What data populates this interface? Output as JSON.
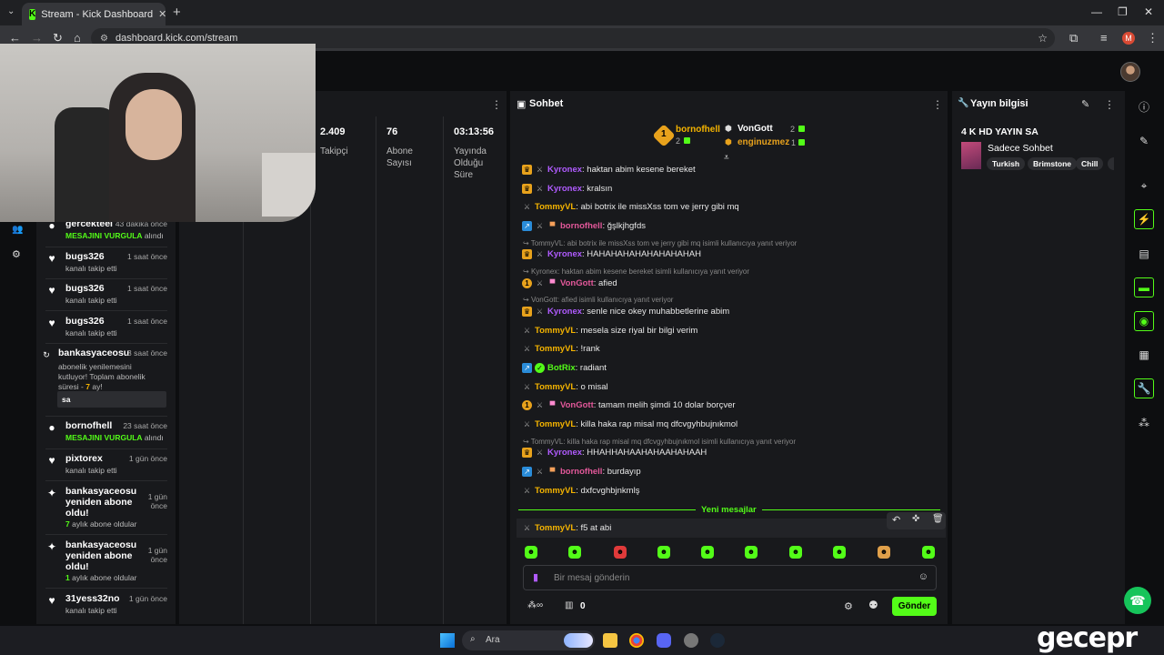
{
  "browser": {
    "tab_title": "Stream - Kick Dashboard",
    "url": "dashboard.kick.com/stream",
    "profile_initial": "M"
  },
  "stats": [
    {
      "value": "2.409",
      "label": "Takipçi"
    },
    {
      "value": "76",
      "label": "Abone Sayısı"
    },
    {
      "value": "03:13:56",
      "label": "Yayında Olduğu Süre"
    }
  ],
  "events": [
    {
      "name": "gercekteel",
      "time": "43 dakika önce",
      "highlight": "MESAJINI VURGULA",
      "sub": "alındı"
    },
    {
      "name": "bugs326",
      "time": "1 saat önce",
      "sub": "kanalı takip etti"
    },
    {
      "name": "bugs326",
      "time": "1 saat önce",
      "sub": "kanalı takip etti"
    },
    {
      "name": "bugs326",
      "time": "1 saat önce",
      "sub": "kanalı takip etti"
    },
    {
      "name": "bankasyaceosu",
      "time": "3 saat önce",
      "text1": "abonelik yenilemesini",
      "text2": "kutluyor! Toplam abonelik",
      "text3": "süresi -",
      "months": "7",
      "months_suffix": "ay!",
      "message": "sa"
    },
    {
      "name": "bornofhell",
      "time": "23 saat önce",
      "highlight": "MESAJINI VURGULA",
      "sub": "alındı"
    },
    {
      "name": "pixtorex",
      "time": "1 gün önce",
      "sub": "kanalı takip etti"
    },
    {
      "name_l1": "bankasyaceosu",
      "name_l2": "yeniden abone",
      "name_l3": "oldu!",
      "time_l1": "1 gün",
      "time_l2": "önce",
      "count": "7",
      "sub": "aylık abone oldular"
    },
    {
      "name_l1": "bankasyaceosu",
      "name_l2": "yeniden abone",
      "name_l3": "oldu!",
      "time_l1": "1 gün",
      "time_l2": "önce",
      "count": "1",
      "sub": "aylık abone oldular"
    },
    {
      "name": "31yess32no",
      "time": "1 gün önce",
      "sub": "kanalı takip etti"
    }
  ],
  "chat": {
    "title": "Sohbet",
    "leaderboard": [
      {
        "rank": "1",
        "name": "bornofhell",
        "count": "2"
      },
      {
        "name": "VonGott",
        "count": "2"
      },
      {
        "name": "enginuzmez",
        "count": "1"
      }
    ],
    "messages": [
      {
        "user": "Kyronex",
        "text": ": haktan abim kesene bereket"
      },
      {
        "user": "Kyronex",
        "text": ": kralsın"
      },
      {
        "user": "TommyVL",
        "text": ": abi botrix ile missXss tom ve jerry gibi mq"
      },
      {
        "user": "bornofhell",
        "text": ": ğşlkjhgfds"
      },
      {
        "reply": "TommyVL: abi botrix ile missXss tom ve jerry gibi mq isimli kullanıcıya yanıt veriyor"
      },
      {
        "user": "Kyronex",
        "text": ": HAHAHAHAHAHAHAHAHAH"
      },
      {
        "reply": "Kyronex: haktan abim kesene bereket isimli kullanıcıya yanıt veriyor"
      },
      {
        "user": "VonGott",
        "text": ": afied"
      },
      {
        "reply": "VonGott: afied isimli kullanıcıya yanıt veriyor"
      },
      {
        "user": "Kyronex",
        "text": ": senle nice okey muhabbetlerine abim"
      },
      {
        "user": "TommyVL",
        "text": ": mesela size riyal bir bilgi verim"
      },
      {
        "user": "TommyVL",
        "text": ": !rank"
      },
      {
        "user": "BotRix",
        "text": ": radiant"
      },
      {
        "user": "TommyVL",
        "text": ": o misal"
      },
      {
        "user": "VonGott",
        "text": ": tamam melih şimdi 10 dolar borçver"
      },
      {
        "user": "TommyVL",
        "text": ": killa haka rap misal mq dfcvgyhbujnıkmol"
      },
      {
        "reply": "TommyVL: killa haka rap misal mq dfcvgyhbujnıkmol isimli kullanıcıya yanıt veriyor"
      },
      {
        "user": "Kyronex",
        "text": ": HHAHHAHAAHAHAAHAHAAH"
      },
      {
        "user": "bornofhell",
        "text": ": burdayıp"
      },
      {
        "user": "TommyVL",
        "text": ": dxfcvghbjnkmlş"
      }
    ],
    "new_messages": "Yeni mesajlar",
    "last_message": {
      "user": "TommyVL",
      "text": ": f5 at abi"
    },
    "input_placeholder": "Bir mesaj gönderin",
    "points": "0",
    "send_label": "Gönder"
  },
  "stream_info": {
    "title": "Yayın bilgisi",
    "stream_title": "4 K HD YAYIN SA",
    "category": "Sadece Sohbet",
    "tags": [
      "Turkish",
      "Brimstone",
      "Chill"
    ]
  },
  "taskbar": {
    "search_label": "Ara"
  },
  "watermark": "gecepr"
}
